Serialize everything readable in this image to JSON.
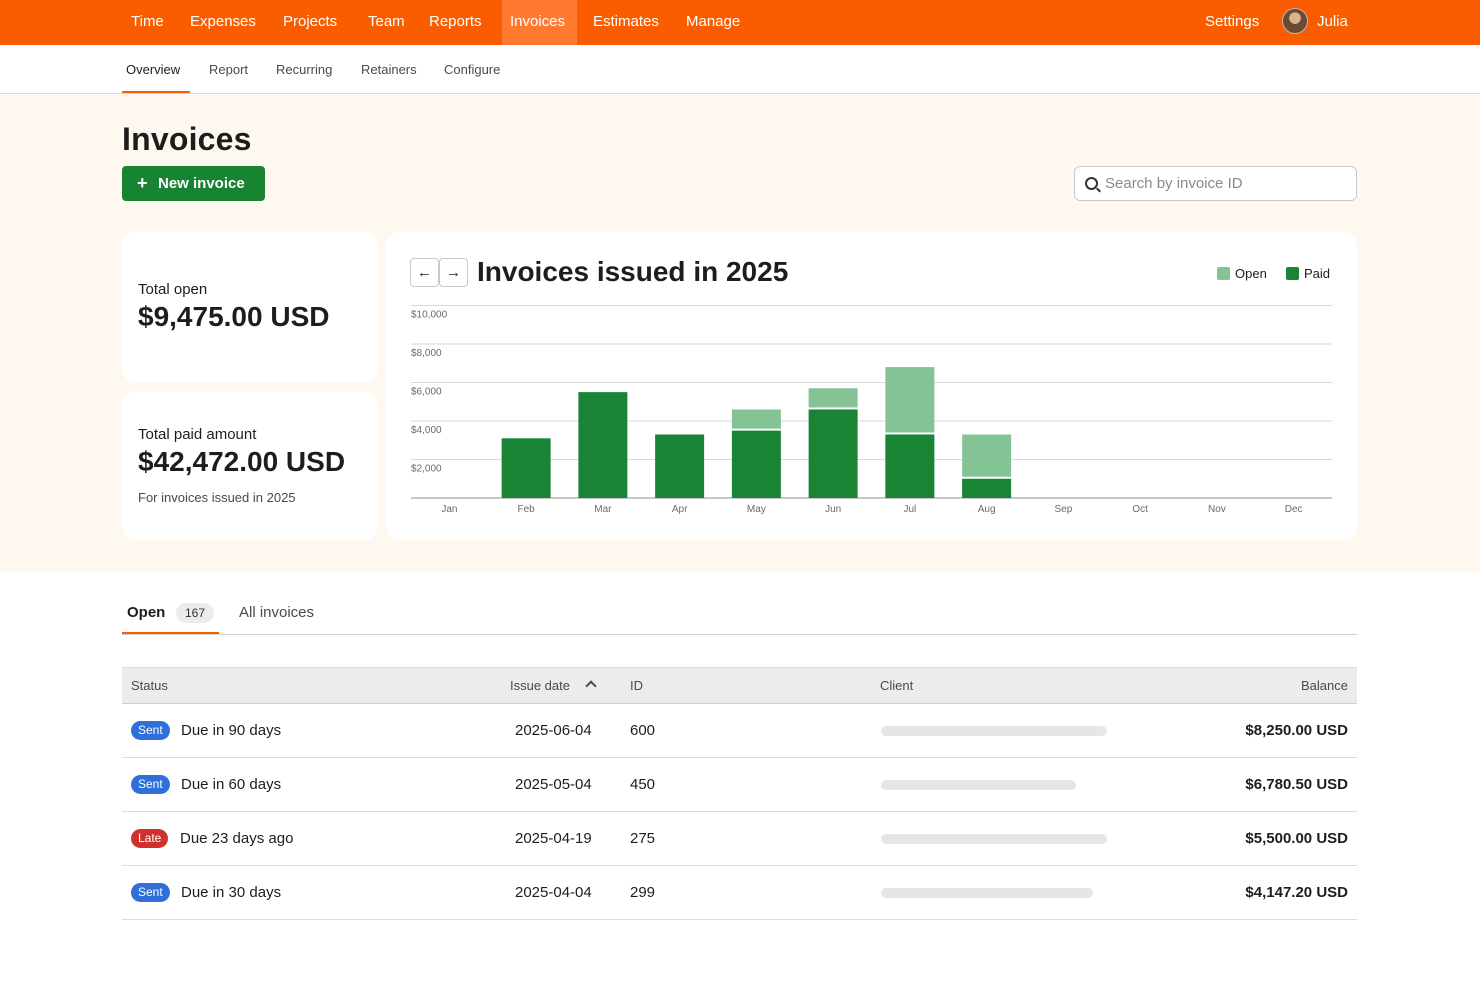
{
  "topnav": {
    "items": [
      {
        "label": "Time"
      },
      {
        "label": "Expenses"
      },
      {
        "label": "Projects"
      },
      {
        "label": "Team"
      },
      {
        "label": "Reports"
      },
      {
        "label": "Invoices",
        "active": true
      },
      {
        "label": "Estimates"
      },
      {
        "label": "Manage"
      }
    ],
    "settings_label": "Settings",
    "user_name": "Julia",
    "brand_color": "#fa5d00"
  },
  "subnav": {
    "items": [
      {
        "label": "Overview",
        "active": true
      },
      {
        "label": "Report"
      },
      {
        "label": "Recurring"
      },
      {
        "label": "Retainers"
      },
      {
        "label": "Configure"
      }
    ]
  },
  "page": {
    "title": "Invoices",
    "new_button_label": "New invoice",
    "new_button_icon": "plus-icon",
    "search_placeholder": "Search by invoice ID",
    "search_icon": "search-icon"
  },
  "stats": {
    "total_open_label": "Total open",
    "total_open_value": "$9,475.00 USD",
    "total_paid_label": "Total paid amount",
    "total_paid_value": "$42,472.00 USD",
    "total_paid_note": "For invoices issued in 2025"
  },
  "chart_header": {
    "prev_icon": "arrow-left-icon",
    "next_icon": "arrow-right-icon"
  },
  "chart_data": {
    "type": "bar",
    "stacked": true,
    "title": "Invoices issued in 2025",
    "categories": [
      "Jan",
      "Feb",
      "Mar",
      "Apr",
      "May",
      "Jun",
      "Jul",
      "Aug",
      "Sep",
      "Oct",
      "Nov",
      "Dec"
    ],
    "series": [
      {
        "name": "Paid",
        "color": "#1a8436",
        "values": [
          0,
          3100,
          5500,
          3300,
          3500,
          4600,
          3300,
          1000,
          0,
          0,
          0,
          0
        ]
      },
      {
        "name": "Open",
        "color": "#84c395",
        "values": [
          0,
          0,
          0,
          0,
          1100,
          1100,
          3500,
          2300,
          0,
          0,
          0,
          0
        ]
      }
    ],
    "y_ticks": [
      "$2,000",
      "$4,000",
      "$6,000",
      "$8,000",
      "$10,000"
    ],
    "ylim": [
      0,
      10000
    ],
    "grid": true,
    "legend_position": "top-right"
  },
  "tabs": {
    "open_label": "Open",
    "open_count": "167",
    "all_label": "All invoices"
  },
  "table": {
    "headers": {
      "status": "Status",
      "issue_date": "Issue date",
      "id": "ID",
      "client": "Client",
      "balance": "Balance"
    },
    "sort_icon": "chevron-up-icon",
    "rows": [
      {
        "badge": "Sent",
        "badge_type": "sent",
        "status_text": "Due in 90 days",
        "issue_date": "2025-06-04",
        "id": "600",
        "balance": "$8,250.00 USD"
      },
      {
        "badge": "Sent",
        "badge_type": "sent",
        "status_text": "Due in 60 days",
        "issue_date": "2025-05-04",
        "id": "450",
        "balance": "$6,780.50 USD"
      },
      {
        "badge": "Late",
        "badge_type": "late",
        "status_text": "Due 23 days ago",
        "issue_date": "2025-04-19",
        "id": "275",
        "balance": "$5,500.00 USD"
      },
      {
        "badge": "Sent",
        "badge_type": "sent",
        "status_text": "Due in 30 days",
        "issue_date": "2025-04-04",
        "id": "299",
        "balance": "$4,147.20 USD"
      }
    ]
  }
}
